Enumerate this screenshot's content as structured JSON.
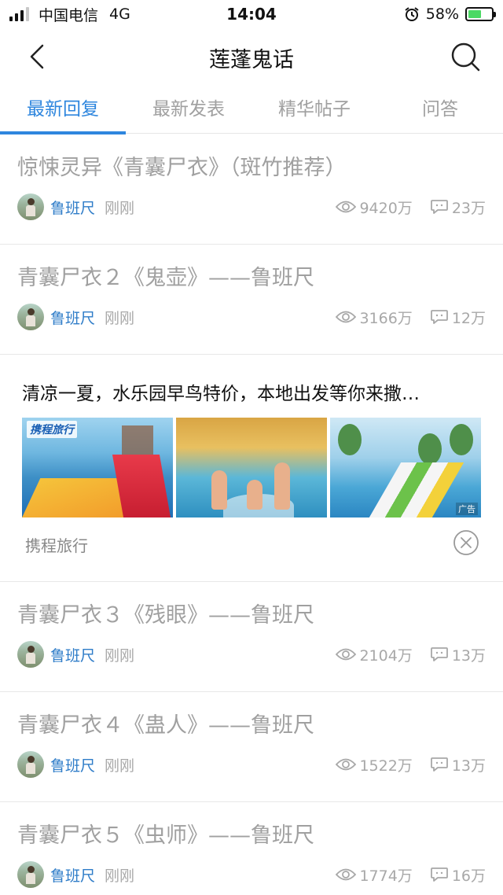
{
  "status_bar": {
    "carrier": "中国电信",
    "network": "4G",
    "time": "14:04",
    "battery": "58%",
    "battery_level": 0.58,
    "icons": [
      "signal-icon",
      "alarm-icon",
      "battery-charging-icon"
    ]
  },
  "nav": {
    "title": "莲蓬鬼话",
    "icons": [
      "back-arrow-icon",
      "search-icon"
    ]
  },
  "tabs": [
    {
      "label": "最新回复",
      "active": true
    },
    {
      "label": "最新发表",
      "active": false
    },
    {
      "label": "精华帖子",
      "active": false
    },
    {
      "label": "问答",
      "active": false
    }
  ],
  "posts": [
    {
      "title": "惊悚灵异《青囊尸衣》（斑竹推荐）",
      "author": "鲁班尺",
      "time": "刚刚",
      "views": "9420万",
      "replies": "23万"
    },
    {
      "title": "青囊尸衣２《鬼壶》——鲁班尺",
      "author": "鲁班尺",
      "time": "刚刚",
      "views": "3166万",
      "replies": "12万"
    },
    {
      "title": "青囊尸衣３《残眼》——鲁班尺",
      "author": "鲁班尺",
      "time": "刚刚",
      "views": "2104万",
      "replies": "13万"
    },
    {
      "title": "青囊尸衣４《蛊人》——鲁班尺",
      "author": "鲁班尺",
      "time": "刚刚",
      "views": "1522万",
      "replies": "13万"
    },
    {
      "title": "青囊尸衣５《虫师》——鲁班尺",
      "author": "鲁班尺",
      "time": "刚刚",
      "views": "1774万",
      "replies": "16万"
    }
  ],
  "ad": {
    "title": "清凉一夏，水乐园早鸟特价，本地出发等你来撒…",
    "brand_logo": "携程旅行",
    "ad_label": "广告",
    "source": "携程旅行",
    "icons": [
      "close-circle-icon"
    ]
  },
  "colors": {
    "accent": "#2e86de",
    "author": "#2e7cc8",
    "muted": "#a0a0a0",
    "battery_fill": "#4cd964"
  }
}
